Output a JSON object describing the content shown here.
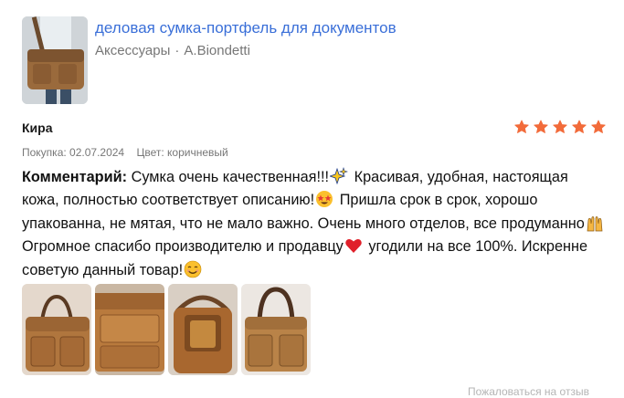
{
  "product": {
    "title": "деловая сумка-портфель для документов",
    "category": "Аксессуары",
    "separator": "·",
    "brand": "A.Biondetti"
  },
  "review": {
    "author": "Кира",
    "rating": 5,
    "rating_max": 5,
    "purchase_label": "Покупка:",
    "purchase_date": "02.07.2024",
    "color_label": "Цвет:",
    "color_value": "коричневый",
    "comment_label": "Комментарий:",
    "comment_parts": [
      "Сумка очень качественная!!!",
      "Красивая, удобная, настоящая кожа, полностью соответствует описанию!",
      "Пришла срок в срок, хорошо упакованна, не мятая, что не мало важно. Очень много отделов, все продуманно",
      "Огромное спасибо производителю и продавцу",
      "угодили на все 100%. Искренне советую данный товар!"
    ],
    "emojis": [
      "sparkles-emoji",
      "star-struck-emoji",
      "raising-hands-emoji",
      "red-heart-emoji",
      "smiling-face-emoji"
    ],
    "photos": [
      {
        "name": "review-photo-1"
      },
      {
        "name": "review-photo-2"
      },
      {
        "name": "review-photo-3"
      },
      {
        "name": "review-photo-4"
      }
    ]
  },
  "footer": {
    "link_text": "Пожаловаться на отзыв"
  },
  "colors": {
    "accent_link": "#3a6fd8",
    "star": "#f26b3a",
    "muted_text": "#777777"
  }
}
